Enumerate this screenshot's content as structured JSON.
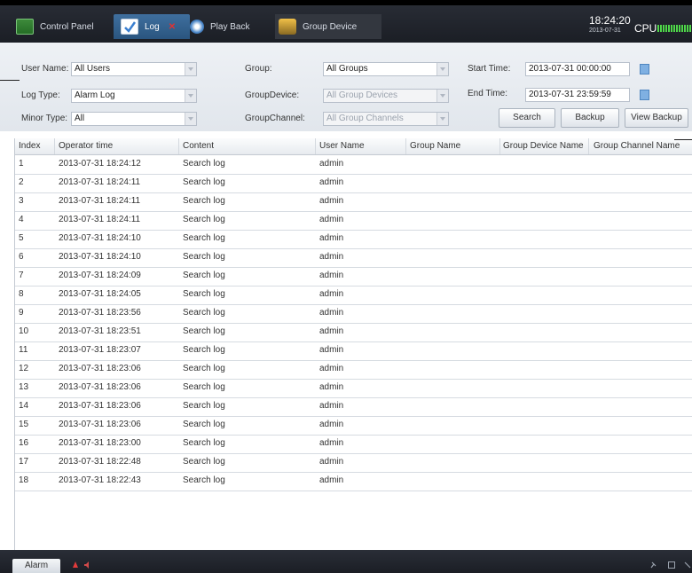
{
  "tabs": [
    {
      "label": "Control Panel",
      "icon": "monitor-icon"
    },
    {
      "label": "Log",
      "icon": "log-icon"
    },
    {
      "label": "Play Back",
      "icon": "playback-icon"
    },
    {
      "label": "Group Device",
      "icon": "group-device-icon"
    }
  ],
  "status": {
    "time": "18:24:20",
    "date": "2013-07-31",
    "cpu_label": "CPU"
  },
  "filters": {
    "user_name_label": "User Name:",
    "user_name_value": "All Users",
    "log_type_label": "Log Type:",
    "log_type_value": "Alarm Log",
    "minor_type_label": "Minor Type:",
    "minor_type_value": "All",
    "group_label": "Group:",
    "group_value": "All Groups",
    "group_device_label": "GroupDevice:",
    "group_device_value": "All Group Devices",
    "group_channel_label": "GroupChannel:",
    "group_channel_value": "All Group Channels",
    "start_time_label": "Start Time:",
    "start_time_value": "2013-07-31 00:00:00",
    "end_time_label": "End Time:",
    "end_time_value": "2013-07-31 23:59:59"
  },
  "buttons": {
    "search": "Search",
    "backup": "Backup",
    "view_backup": "View Backup"
  },
  "table": {
    "headers": [
      "Index",
      "Operator time",
      "Content",
      "User Name",
      "Group Name",
      "Group Device Name",
      "Group Channel Name"
    ],
    "rows": [
      [
        "1",
        "2013-07-31 18:24:12",
        "Search log",
        "admin"
      ],
      [
        "2",
        "2013-07-31 18:24:11",
        "Search log",
        "admin"
      ],
      [
        "3",
        "2013-07-31 18:24:11",
        "Search log",
        "admin"
      ],
      [
        "4",
        "2013-07-31 18:24:11",
        "Search log",
        "admin"
      ],
      [
        "5",
        "2013-07-31 18:24:10",
        "Search log",
        "admin"
      ],
      [
        "6",
        "2013-07-31 18:24:10",
        "Search log",
        "admin"
      ],
      [
        "7",
        "2013-07-31 18:24:09",
        "Search log",
        "admin"
      ],
      [
        "8",
        "2013-07-31 18:24:05",
        "Search log",
        "admin"
      ],
      [
        "9",
        "2013-07-31 18:23:56",
        "Search log",
        "admin"
      ],
      [
        "10",
        "2013-07-31 18:23:51",
        "Search log",
        "admin"
      ],
      [
        "11",
        "2013-07-31 18:23:07",
        "Search log",
        "admin"
      ],
      [
        "12",
        "2013-07-31 18:23:06",
        "Search log",
        "admin"
      ],
      [
        "13",
        "2013-07-31 18:23:06",
        "Search log",
        "admin"
      ],
      [
        "14",
        "2013-07-31 18:23:06",
        "Search log",
        "admin"
      ],
      [
        "15",
        "2013-07-31 18:23:06",
        "Search log",
        "admin"
      ],
      [
        "16",
        "2013-07-31 18:23:00",
        "Search log",
        "admin"
      ],
      [
        "17",
        "2013-07-31 18:22:48",
        "Search log",
        "admin"
      ],
      [
        "18",
        "2013-07-31 18:22:43",
        "Search log",
        "admin"
      ]
    ]
  },
  "footer": {
    "alarm_tab": "Alarm"
  },
  "colors": {
    "active_tab": "#3f6f9e",
    "cpu_bar": "#4fd64a",
    "close": "#e03232"
  }
}
